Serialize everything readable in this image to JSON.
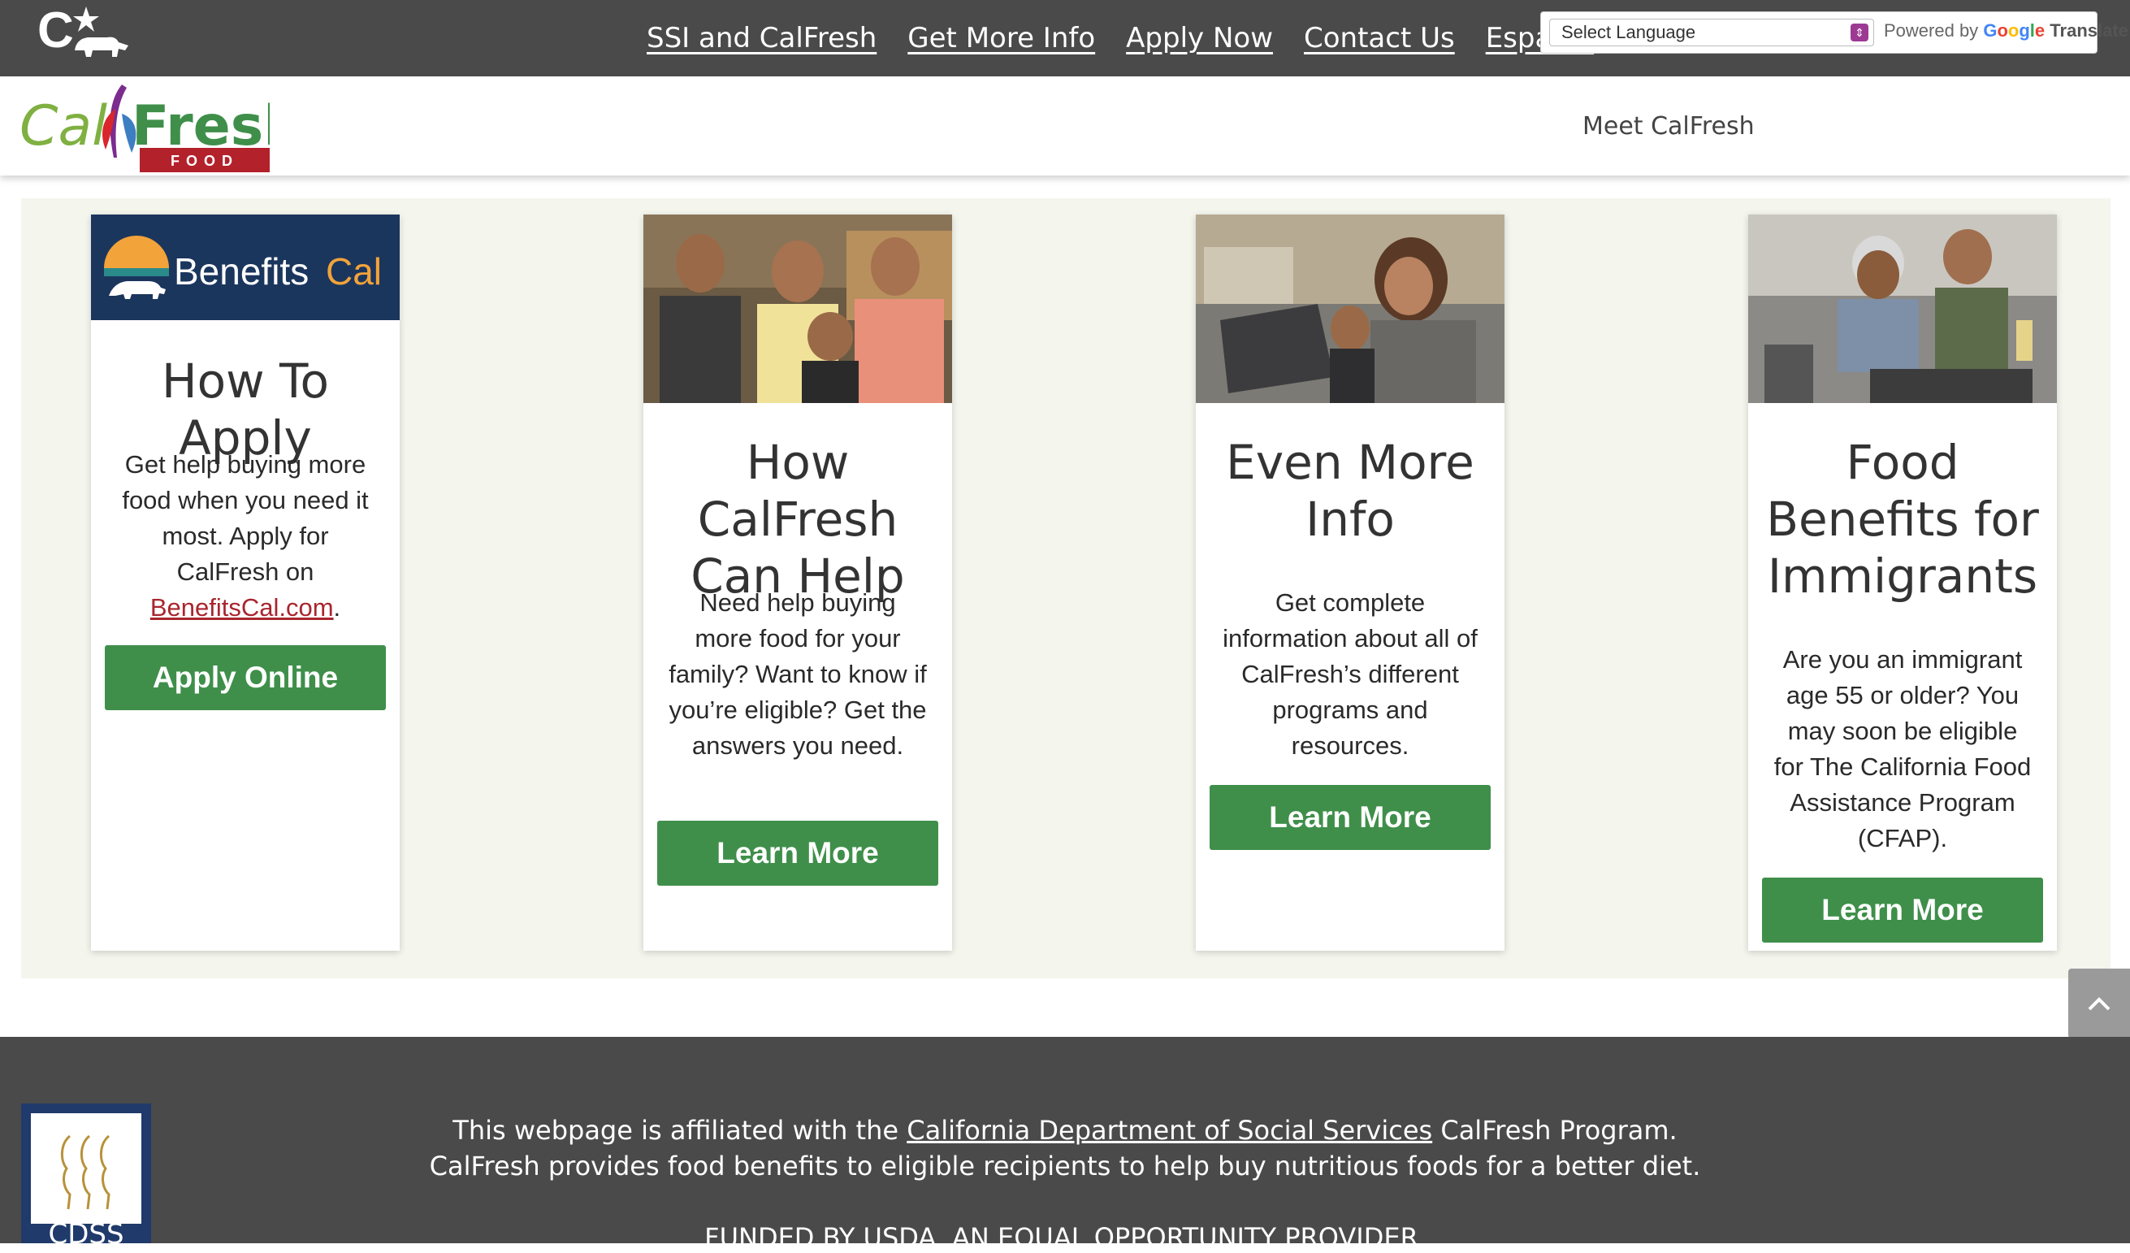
{
  "topbar": {
    "nav": [
      "SSI and CalFresh",
      "Get More Info",
      "Apply Now",
      "Contact Us",
      "Español"
    ],
    "translate": {
      "select_label": "Select Language",
      "powered_by": "Powered by",
      "google": "Google",
      "translate": "Translate"
    }
  },
  "header": {
    "logo_text": "CalFresh",
    "logo_sub": "FOOD",
    "meet_link": "Meet CalFresh"
  },
  "cards": [
    {
      "brand_text": "Benefits",
      "brand_text_accent": "Cal",
      "title": "How To Apply",
      "text_before_link": "Get help buying more food when you need it most. Apply for CalFresh on ",
      "link": "BenefitsCal.com",
      "text_after_link": ".",
      "button": "Apply Online"
    },
    {
      "title": "How CalFresh Can Help",
      "text": "Need help buying more food for your family? Want to know if you’re eligible? Get the answers you need.",
      "button": "Learn More"
    },
    {
      "title": "Even More Info",
      "text": "Get complete information about all of CalFresh’s different programs and resources.",
      "button": "Learn More"
    },
    {
      "title": "Food Benefits for Immigrants",
      "text": "Are you an immigrant age 55 or older? You may soon be eligible for The California Food Assistance Program (CFAP).",
      "button": "Learn More"
    }
  ],
  "footer": {
    "line1_before": "This webpage is affiliated with the ",
    "line1_link": "California Department of Social Services",
    "line1_after": " CalFresh Program.",
    "line2": "CalFresh provides food benefits to eligible recipients to help buy nutritious foods for a better diet.",
    "line3": "FUNDED BY USDA. AN EQUAL OPPORTUNITY PROVIDER.",
    "logo_text": "CDSS"
  },
  "colors": {
    "topbar": "#4a4a4a",
    "button_green": "#3f8f4a",
    "link_red": "#a8262e",
    "band_bg": "#f4f6ee",
    "benefitscal_navy": "#1b365d",
    "benefitscal_orange": "#f2a33a"
  }
}
